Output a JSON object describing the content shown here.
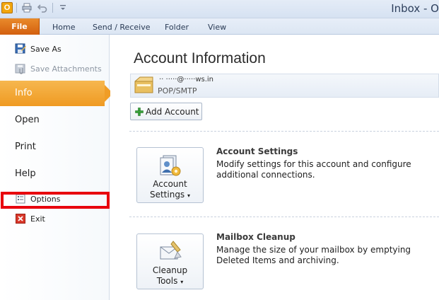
{
  "window": {
    "title": "Inbox - O"
  },
  "quick_access": {
    "app_icon": "outlook-icon",
    "buttons": [
      "print-icon",
      "undo-icon",
      "customize-icon"
    ]
  },
  "tabs": [
    {
      "label": "File",
      "active": true
    },
    {
      "label": "Home"
    },
    {
      "label": "Send / Receive"
    },
    {
      "label": "Folder"
    },
    {
      "label": "View"
    }
  ],
  "backstage": {
    "save_as": "Save As",
    "save_attachments": "Save Attachments",
    "info": "Info",
    "open": "Open",
    "print": "Print",
    "help": "Help",
    "options": "Options",
    "exit": "Exit"
  },
  "main": {
    "title": "Account Information",
    "account_name": "·· ·····@·····ws.in",
    "account_type": "POP/SMTP",
    "add_account": "Add Account",
    "account_settings": {
      "button_line1": "Account",
      "button_line2": "Settings",
      "title": "Account Settings",
      "description": "Modify settings for this account and configure additional connections."
    },
    "mailbox_cleanup": {
      "button_line1": "Cleanup",
      "button_line2": "Tools",
      "title": "Mailbox Cleanup",
      "description": "Manage the size of your mailbox by emptying Deleted Items and archiving."
    }
  },
  "colors": {
    "file_tab": "#d9691a",
    "active_nav": "#f0a030",
    "highlight": "#e8000d"
  }
}
